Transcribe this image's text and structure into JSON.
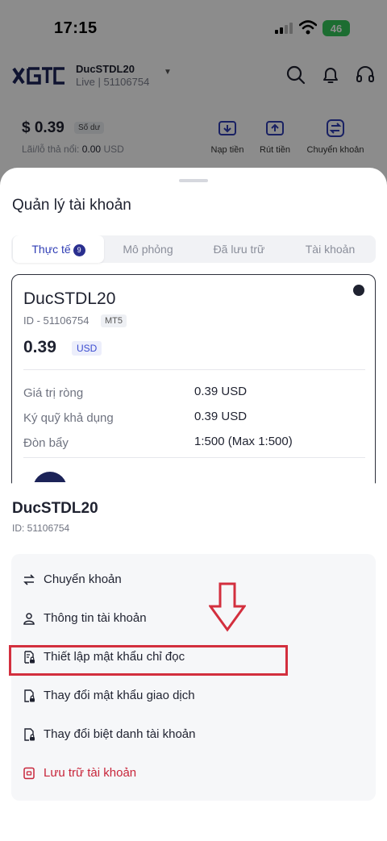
{
  "status_bar": {
    "time": "17:15",
    "battery": "46"
  },
  "header": {
    "logo_icon": "xgtc-logo",
    "account_name": "DucSTDL20",
    "account_sub": "Live  |  51106754",
    "icons": [
      "search-icon",
      "bell-icon",
      "headset-icon"
    ]
  },
  "balance": {
    "amount": "$ 0.39",
    "tag": "Số dư",
    "pnl_label": "Lãi/lỗ thả nổi:",
    "pnl_value": "0.00",
    "pnl_currency": "USD",
    "actions": [
      {
        "label": "Nạp tiền",
        "icon": "deposit-icon"
      },
      {
        "label": "Rút tiền",
        "icon": "withdraw-icon"
      },
      {
        "label": "Chuyển khoản",
        "icon": "transfer-icon"
      }
    ]
  },
  "manage_sheet": {
    "title": "Quản lý tài khoản",
    "tabs": [
      {
        "label": "Thực tế",
        "badge": "9",
        "active": true
      },
      {
        "label": "Mô phỏng"
      },
      {
        "label": "Đã lưu trữ"
      },
      {
        "label": "Tài khoản"
      }
    ],
    "card": {
      "name": "DucSTDL20",
      "id": "ID - 51106754",
      "platform": "MT5",
      "balance": "0.39",
      "currency": "USD",
      "stats": [
        {
          "label": "Giá trị ròng",
          "value": "0.39 USD"
        },
        {
          "label": "Ký quỹ khả dụng",
          "value": "0.39 USD"
        },
        {
          "label": "Đòn bẩy",
          "value": "1:500 (Max 1:500)"
        }
      ]
    }
  },
  "action_sheet": {
    "title": "DucSTDL20",
    "id": "ID: 51106754",
    "items": [
      {
        "label": "Chuyển khoản",
        "icon": "transfer-arrows-icon"
      },
      {
        "label": "Thông tin tài khoản",
        "icon": "user-icon"
      },
      {
        "label": "Thiết lập mật khẩu chỉ đọc",
        "icon": "document-lock-icon",
        "highlighted": true
      },
      {
        "label": "Thay đổi mật khẩu giao dịch",
        "icon": "file-lock-icon"
      },
      {
        "label": "Thay đổi biệt danh tài khoản",
        "icon": "file-lock-icon"
      },
      {
        "label": "Lưu trữ tài khoản",
        "icon": "archive-icon",
        "danger": true
      }
    ]
  },
  "colors": {
    "accent": "#2f3db5",
    "danger": "#c8253a",
    "highlight": "#d32f3e"
  }
}
